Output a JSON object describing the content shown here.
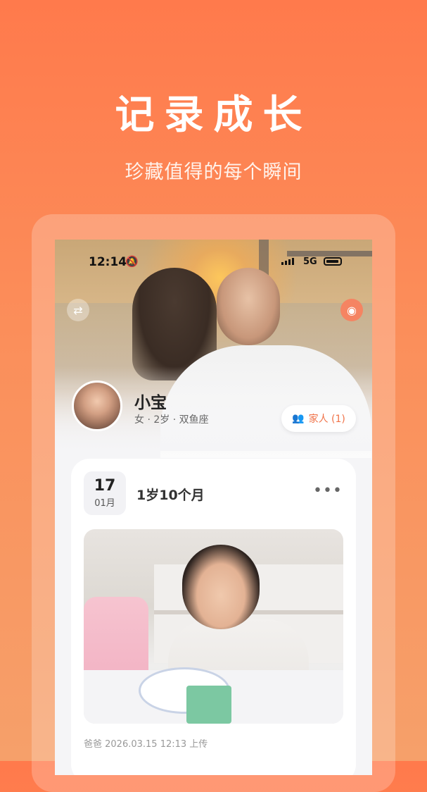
{
  "promo": {
    "headline": "记录成长",
    "subtitle": "珍藏值得的每个瞬间"
  },
  "status_bar": {
    "time": "12:14",
    "network": "5G",
    "icons": [
      "bell-muted-icon",
      "signal-icon",
      "battery-icon"
    ]
  },
  "header": {
    "swap_icon": "⇄",
    "camera_icon": "◉"
  },
  "profile": {
    "name": "小宝",
    "info": "女 · 2岁 · 双鱼座",
    "family_button": "家人 (1)",
    "family_icon": "👥"
  },
  "entry": {
    "date_day": "17",
    "date_month": "01月",
    "age": "1岁10个月",
    "more": "•••",
    "meta": "爸爸 2026.03.15 12:13 上传"
  },
  "colors": {
    "accent": "#f07349",
    "background_top": "#ff7a4c",
    "background_bottom": "#f6a06a"
  }
}
